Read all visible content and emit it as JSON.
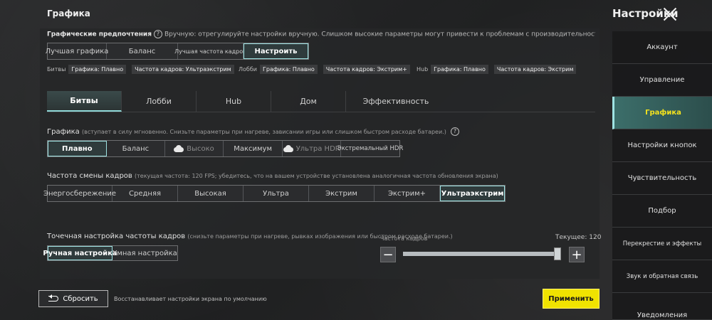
{
  "header": {
    "title": "Графика",
    "settings_title": "Настройки"
  },
  "preferences": {
    "desc_strong": "Графические предпочтения",
    "desc_rest": "Вручную: отрегулируйте настройки вручную. Слишком высокие параметры могут привести к проблемам с производительностью, такими как перегрев, быстрый разряд батареи",
    "options": [
      "Лучшая графика",
      "Баланс",
      "Лучшая частота кадров",
      "Настроить"
    ],
    "active_index": 3,
    "summary": {
      "battles": {
        "label": "Битвы",
        "graphics": "Графика: Плавно",
        "fps": "Частота кадров: Ультраэкстрим"
      },
      "lobby": {
        "label": "Лобби",
        "graphics": "Графика: Плавно",
        "fps": "Частота кадров: Экстрим+"
      },
      "hub": {
        "label": "Hub",
        "graphics": "Графика: Плавно",
        "fps": "Частота кадров: Экстрим"
      }
    }
  },
  "tabs": [
    "Битвы",
    "Лобби",
    "Hub",
    "Дом",
    "Эффективность"
  ],
  "graphics": {
    "label": "Графика",
    "hint": "(вступает в силу мгновенно. Снизьте параметры при нагреве, зависании игры или слишком быстром расходе батареи.)",
    "options": [
      "Плавно",
      "Баланс",
      "Высоко",
      "Максимум",
      "Ультра HDR",
      "Экстремальный HDR"
    ],
    "active_index": 0
  },
  "fps": {
    "label": "Частота смены кадров",
    "hint": "(текущая частота: 120 FPS; убедитесь, что на вашем устройстве установлена аналогичная частота обновления экрана)",
    "options": [
      "Энергосбережение",
      "Средняя",
      "Высокая",
      "Ультра",
      "Экстрим",
      "Экстрим+",
      "Ультраэкстрим"
    ],
    "active_index": 6
  },
  "fine_tune": {
    "label": "Точечная настройка частоты кадров",
    "hint": "(снизьте параметры при нагреве, рывках изображения или быстром расходе батареи.)",
    "options": [
      "Ручная настройка",
      "Умная настройка"
    ],
    "active_index": 0,
    "slider_label": "Частота кадров",
    "current_label": "Текущее: 120",
    "slider_fraction": 1.0
  },
  "footer": {
    "reset_label": "Сбросить",
    "reset_desc": "Восстанавливает настройки экрана по умолчанию",
    "apply_label": "Применить"
  },
  "sidebar": {
    "items": [
      "Аккаунт",
      "Управление",
      "Графика",
      "Настройки кнопок",
      "Чувствительность",
      "Подбор",
      "Перекрестие и эффекты",
      "Звук и обратная связь",
      "Уведомления"
    ],
    "active_index": 2
  },
  "colors": {
    "accent": "#9fe3e3",
    "apply": "#f0e300",
    "active_text": "#f4e21e"
  }
}
